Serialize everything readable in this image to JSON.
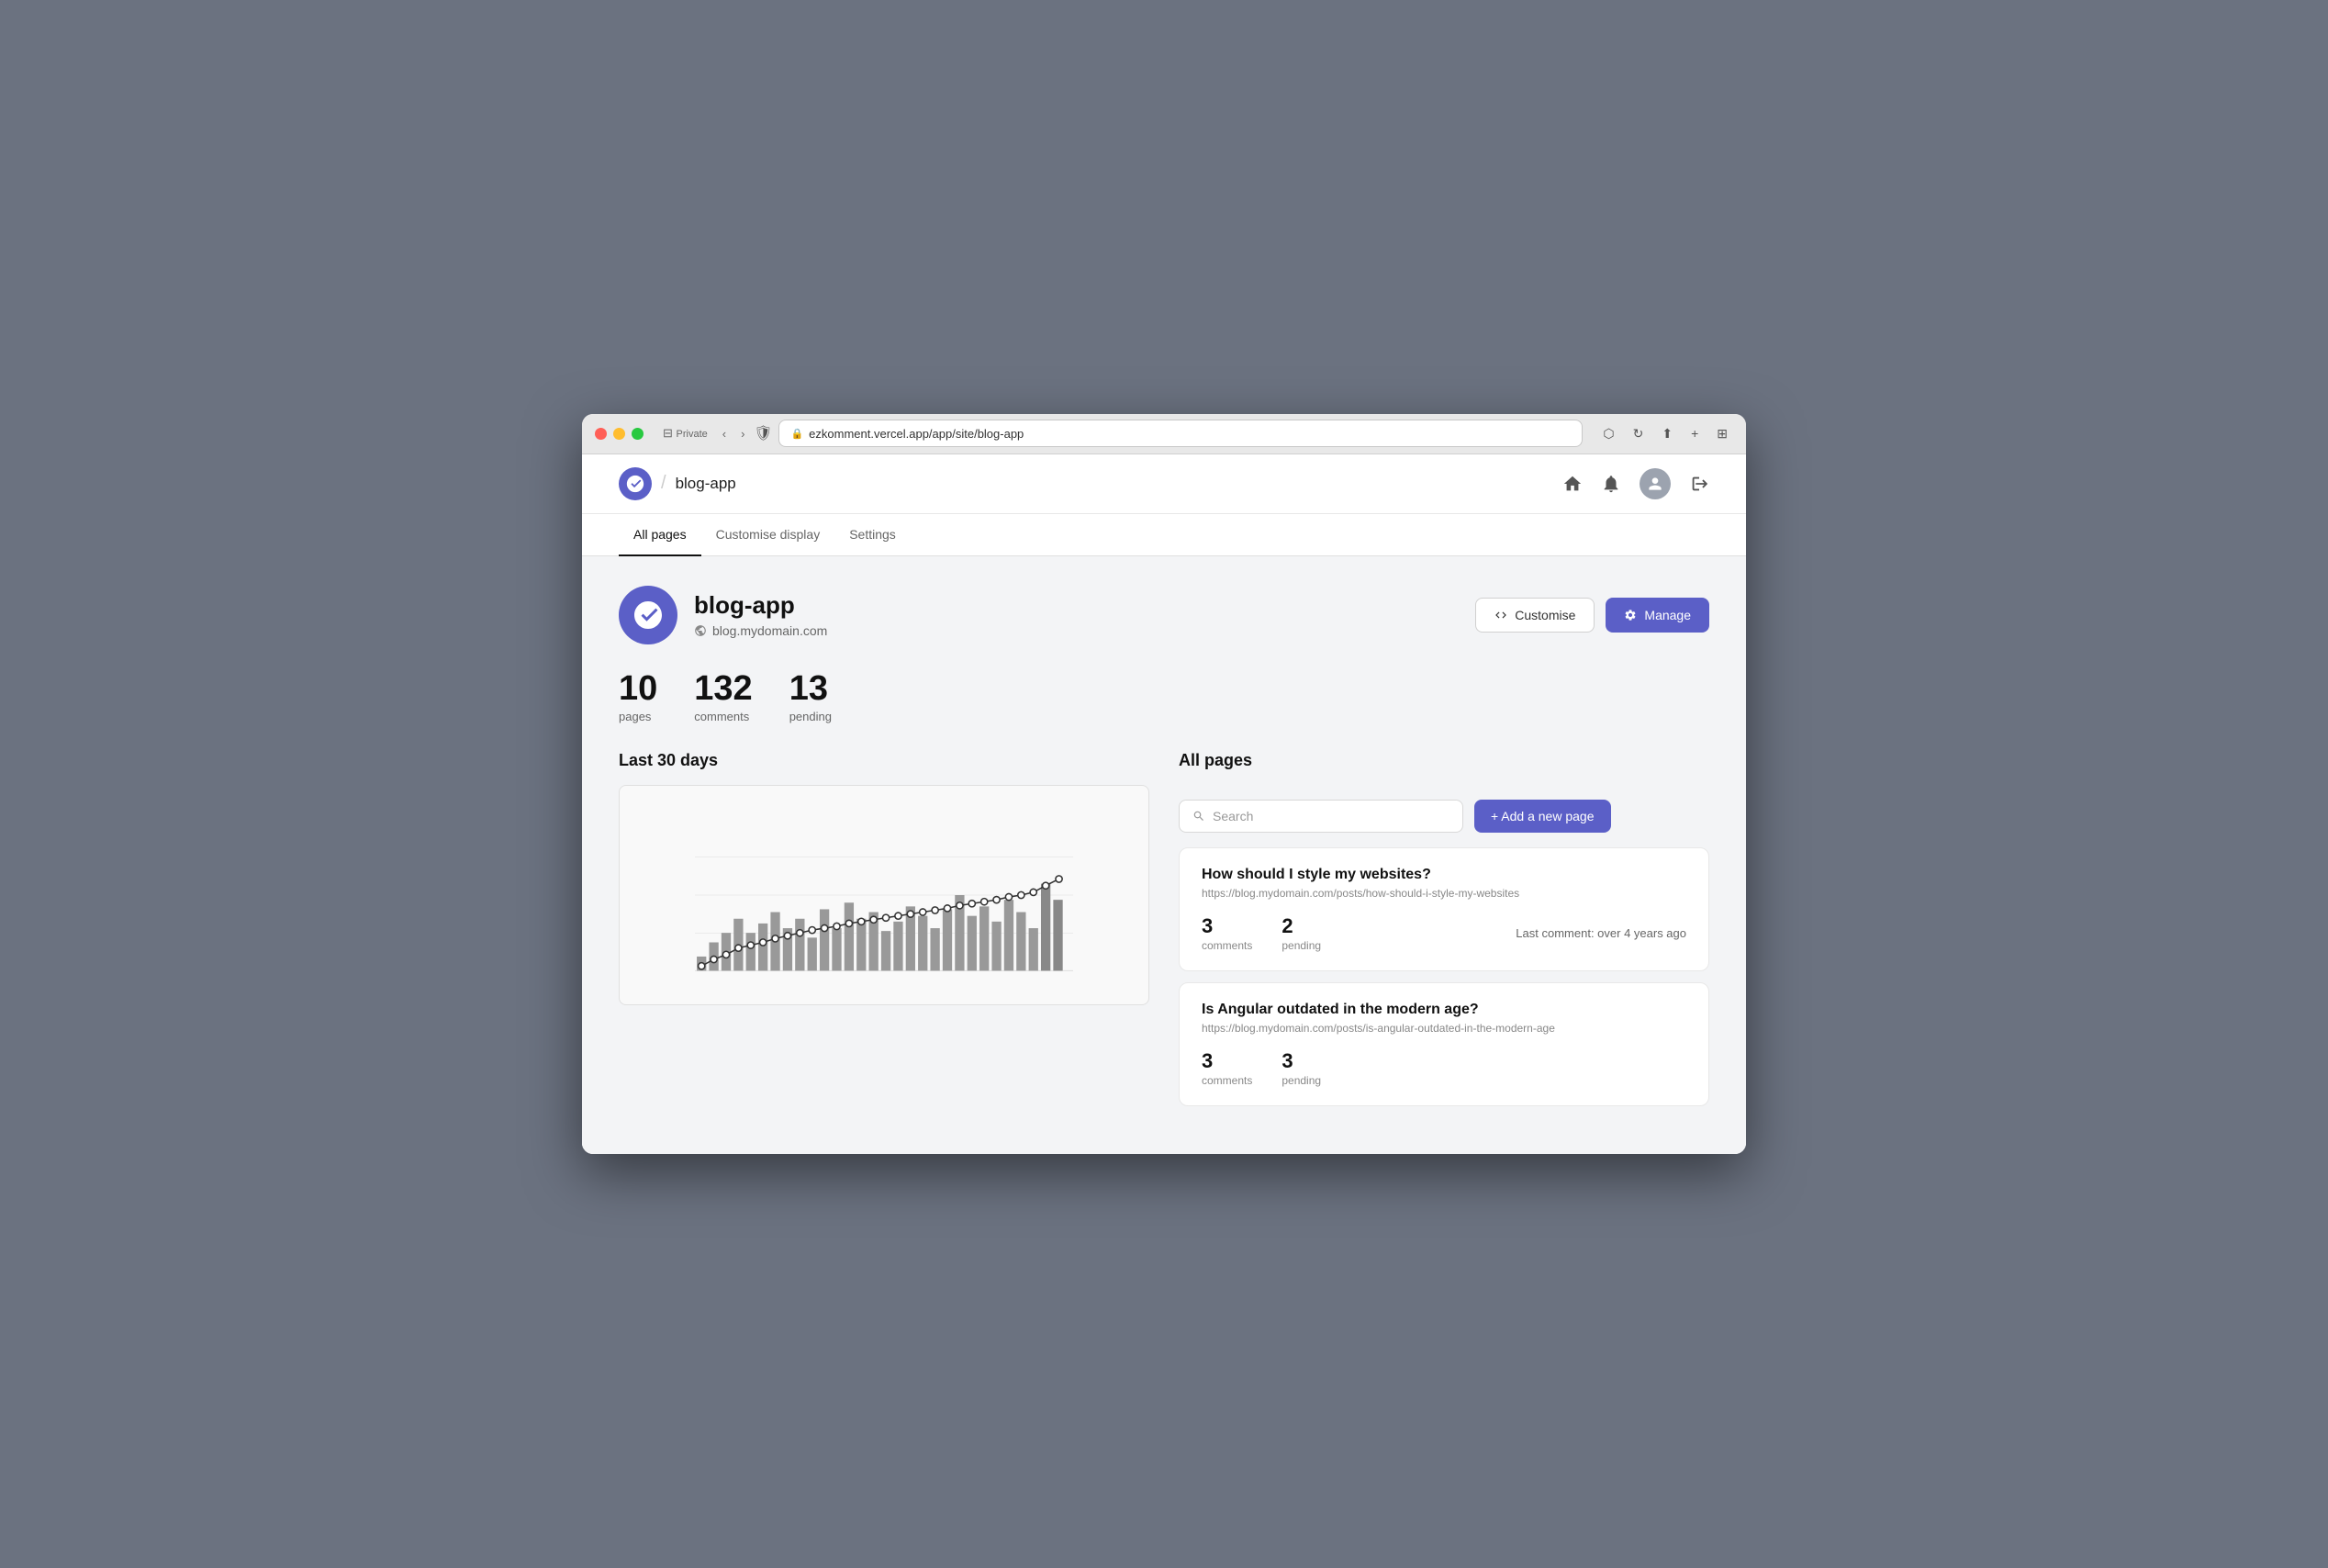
{
  "browser": {
    "url": "ezkomment.vercel.app/app/site/blog-app",
    "mode": "Private"
  },
  "topnav": {
    "brand": "blog-app",
    "logo_symbol": "✓",
    "home_icon": "⌂",
    "bell_icon": "🔔",
    "logout_icon": "→"
  },
  "tabs": [
    {
      "label": "All pages",
      "active": true
    },
    {
      "label": "Customise display",
      "active": false
    },
    {
      "label": "Settings",
      "active": false
    }
  ],
  "site": {
    "name": "blog-app",
    "domain": "blog.mydomain.com",
    "stats": {
      "pages": {
        "value": "10",
        "label": "pages"
      },
      "comments": {
        "value": "132",
        "label": "comments"
      },
      "pending": {
        "value": "13",
        "label": "pending"
      }
    },
    "chart_title": "Last 30 days",
    "all_pages_title": "All pages"
  },
  "buttons": {
    "customise": "Customise",
    "manage": "Manage",
    "add_page": "+ Add a new page",
    "search_placeholder": "Search"
  },
  "pages": [
    {
      "title": "How should I style my websites?",
      "url": "https://blog.mydomain.com/posts/how-should-i-style-my-websites",
      "comments": "3",
      "pending": "2",
      "last_comment": "Last comment: over 4 years ago"
    },
    {
      "title": "Is Angular outdated in the modern age?",
      "url": "https://blog.mydomain.com/posts/is-angular-outdated-in-the-modern-age",
      "comments": "3",
      "pending": "3",
      "last_comment": ""
    }
  ],
  "chart": {
    "bars": [
      2,
      5,
      8,
      12,
      7,
      10,
      14,
      9,
      11,
      6,
      13,
      8,
      15,
      10,
      12,
      7,
      9,
      14,
      11,
      8,
      13,
      16,
      10,
      12,
      9,
      14,
      11,
      8,
      17,
      13
    ],
    "trend": [
      2,
      4,
      5,
      7,
      8,
      9,
      10,
      11,
      12,
      13,
      13.5,
      14,
      15,
      15.5,
      16,
      16.5,
      17,
      17.5,
      18,
      18.5,
      19,
      20,
      20.5,
      21,
      21.5,
      22,
      23,
      24,
      25,
      27
    ]
  }
}
